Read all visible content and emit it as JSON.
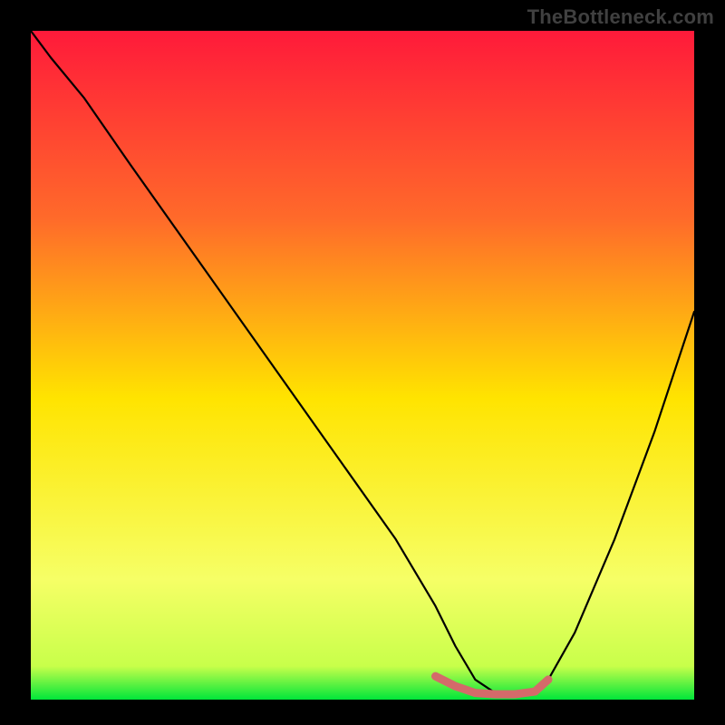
{
  "watermark": "TheBottleneck.com",
  "colors": {
    "frame": "#000000",
    "gradient_top": "#ff1a3a",
    "gradient_mid_upper": "#ff8a2a",
    "gradient_mid": "#ffe400",
    "gradient_lower": "#f8ff60",
    "gradient_bottom": "#00e63a",
    "curve": "#000000",
    "highlight": "#d46a6a"
  },
  "chart_data": {
    "type": "line",
    "title": "",
    "xlabel": "",
    "ylabel": "",
    "xlim": [
      0,
      100
    ],
    "ylim": [
      0,
      100
    ],
    "series": [
      {
        "name": "bottleneck-curve",
        "x": [
          0,
          3,
          8,
          15,
          25,
          35,
          45,
          55,
          61,
          64,
          67,
          70,
          73,
          76,
          78,
          82,
          88,
          94,
          100
        ],
        "y": [
          100,
          96,
          90,
          80,
          66,
          52,
          38,
          24,
          14,
          8,
          3,
          1,
          0.5,
          1,
          3,
          10,
          24,
          40,
          58
        ]
      }
    ],
    "highlight_segment": {
      "name": "flat-minimum",
      "x": [
        61,
        64,
        67,
        70,
        73,
        76,
        78
      ],
      "y": [
        3.5,
        2,
        1,
        0.8,
        0.8,
        1.2,
        3
      ]
    }
  }
}
